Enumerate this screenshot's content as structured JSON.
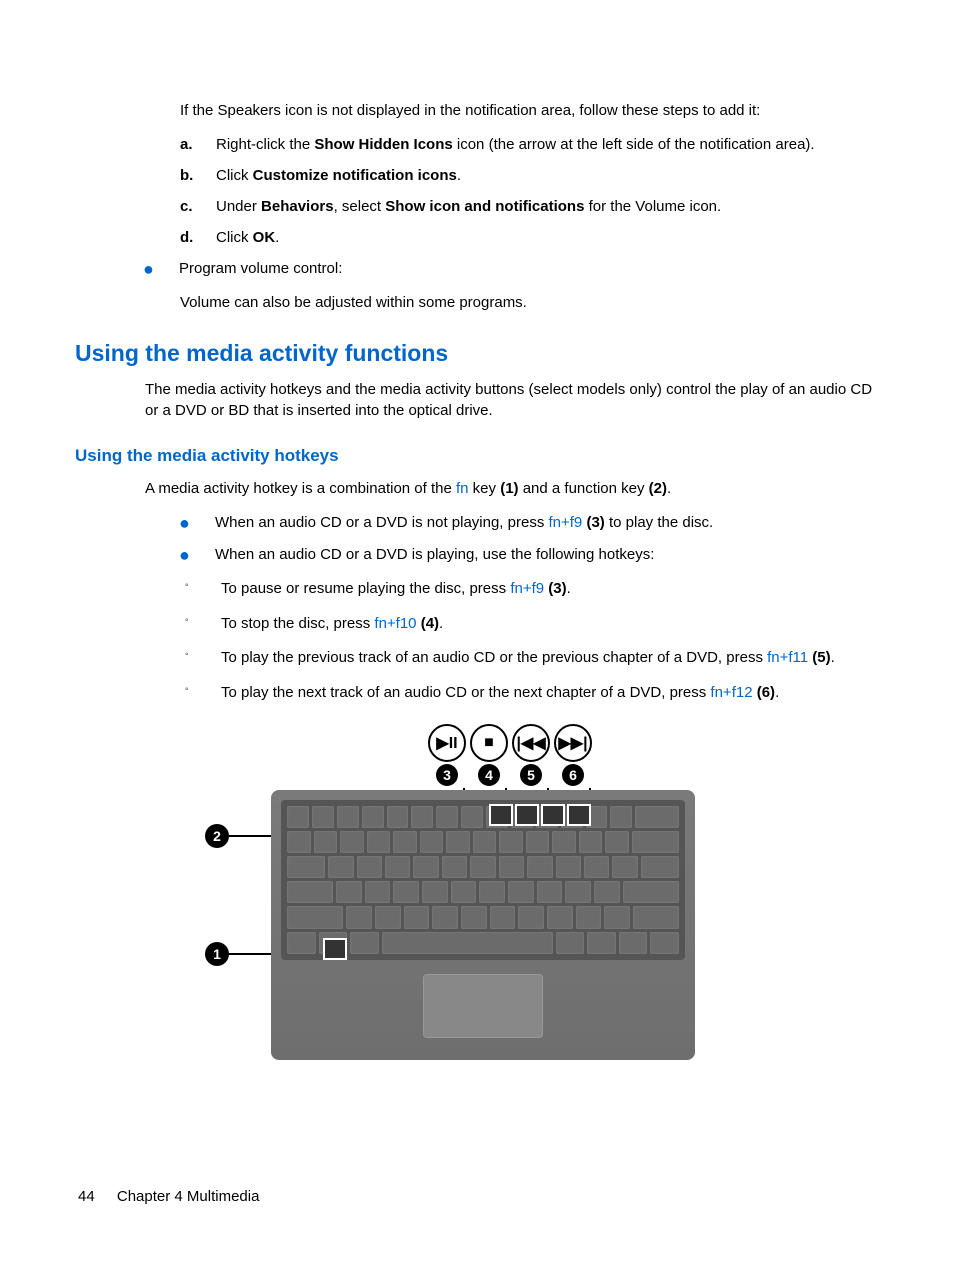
{
  "intro_p": "If the Speakers icon is not displayed in the notification area, follow these steps to add it:",
  "steps": {
    "a": {
      "letter": "a.",
      "pre": "Right-click the ",
      "bold1": "Show Hidden Icons",
      "post": " icon (the arrow at the left side of the notification area)."
    },
    "b": {
      "letter": "b.",
      "pre": "Click ",
      "bold1": "Customize notification icons",
      "post": "."
    },
    "c": {
      "letter": "c.",
      "pre": "Under ",
      "bold1": "Behaviors",
      "mid": ", select ",
      "bold2": "Show icon and notifications",
      "post": " for the Volume icon."
    },
    "d": {
      "letter": "d.",
      "pre": "Click ",
      "bold1": "OK",
      "post": "."
    }
  },
  "program_volume": {
    "label": "Program volume control:",
    "desc": "Volume can also be adjusted within some programs."
  },
  "h1": "Using the media activity functions",
  "h1_body": "The media activity hotkeys and the media activity buttons (select models only) control the play of an audio CD or a DVD or BD that is inserted into the optical drive.",
  "h2": "Using the media activity hotkeys",
  "h2_body": {
    "pre": "A media activity hotkey is a combination of the ",
    "fn": "fn",
    "mid1": " key ",
    "b1": "(1)",
    "mid2": " and a function key ",
    "b2": "(2)",
    "post": "."
  },
  "bullets": {
    "b1": {
      "pre": "When an audio CD or a DVD is not playing, press ",
      "hot": "fn+f9",
      "mid": " ",
      "bold": "(3)",
      "post": " to play the disc."
    },
    "b2": {
      "text": "When an audio CD or a DVD is playing, use the following hotkeys:"
    }
  },
  "sub": {
    "s1": {
      "pre": "To pause or resume playing the disc, press ",
      "hot": "fn+f9",
      "bold": "(3)",
      "post": "."
    },
    "s2": {
      "pre": "To stop the disc, press ",
      "hot": "fn+f10",
      "bold": "(4)",
      "post": "."
    },
    "s3": {
      "pre": "To play the previous track of an audio CD or the previous chapter of a DVD, press ",
      "hot": "fn+f11",
      "bold": "(5)",
      "post": "."
    },
    "s4": {
      "pre": "To play the next track of an audio CD or the next chapter of a DVD, press ",
      "hot": "fn+f12",
      "bold": "(6)",
      "post": "."
    }
  },
  "callout_nums": {
    "c1": "1",
    "c2": "2",
    "c3": "3",
    "c4": "4",
    "c5": "5",
    "c6": "6"
  },
  "media_symbols": {
    "play": "▶II",
    "stop": "■",
    "prev": "|◀◀",
    "next": "▶▶|"
  },
  "footer": {
    "page": "44",
    "chapter": "Chapter 4   Multimedia"
  }
}
